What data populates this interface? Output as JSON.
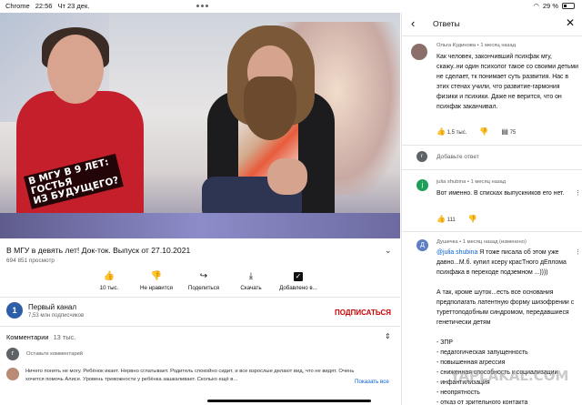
{
  "status_bar": {
    "browser": "Chrome",
    "time": "22:56",
    "date": "Чт 23 дек.",
    "battery": "29 %"
  },
  "video": {
    "overlay_caption": [
      "В МГУ В 9 ЛЕТ:",
      "ГОСТЬЯ",
      "ИЗ БУДУЩЕГО?"
    ],
    "title": "В МГУ в девять лет! Док-ток. Выпуск от 27.10.2021",
    "views": "694 851 просмотр"
  },
  "actions": [
    {
      "icon": "like-icon",
      "glyph": "👍",
      "label": "10 тыс."
    },
    {
      "icon": "dislike-icon",
      "glyph": "👎",
      "label": "Не нравится"
    },
    {
      "icon": "share-icon",
      "glyph": "↪",
      "label": "Поделиться"
    },
    {
      "icon": "download-icon",
      "glyph": "⤓",
      "label": "Скачать"
    },
    {
      "icon": "save-icon",
      "glyph": "✓",
      "label": "Добавлено в..."
    }
  ],
  "channel": {
    "logo": "1",
    "name": "Первый канал",
    "subscribers": "7,53 млн подписчиков",
    "subscribe_label": "ПОДПИСАТЬСЯ"
  },
  "comments": {
    "header": "Комментарии",
    "count": "13 тыс.",
    "add_placeholder": "Оставьте комментарий",
    "top_comment": "Ничего понять не могу. Ребёнок икает. Нервно сглатывает. Родитель спокойно сидит, и все взрослые делают вид, что не видят. Очень хочется помочь Алисе. Уровень тревожности у ребёнка зашкаливает. Сколько ещё в...",
    "show_all": "Показать все"
  },
  "panel": {
    "title": "Ответы",
    "main_comment": {
      "author": "Ольга Кудинова",
      "time": "1 месяц назад",
      "text": "Как человек, закончивший психфак мгу, скажу..ни один психолог такое со своими детьми не сделает, тк понимает суть развития. Нас в этих стенах учили, что развитие-гармония физики и психики. Даже не верится, что он психфак заканчивал.",
      "likes": "1,5 тыс.",
      "replies": "75"
    },
    "reply_avatar": "r",
    "add_reply": "Добавьте ответ",
    "replies": [
      {
        "avatar_letter": "j",
        "author": "julia shubina",
        "time": "1 месяц назад",
        "text": "Вот именно. В списках выпускников его нет.",
        "likes": "111"
      },
      {
        "avatar_letter": "Д",
        "author": "Душечка",
        "time": "1 месяц назад (изменено)",
        "mention": "@julia shubina",
        "text": " Я тоже писала об этом уже давно...М.б. купил ксеру красТного дЕплома психфака в переходе подземном ...))))",
        "text2": "А так, кроме шуток...есть все основания предполагать латентную форму шизофрении с туреттоподобным синдромом, передавшиеся генетически детям",
        "list": [
          "- ЗПР",
          "- педагогическая запущенность",
          "- повышенная агрессия",
          "- сниженная способность к социализации",
          "- инфантилизация",
          "- неопрятность",
          "- отказ от зрительного контакта"
        ]
      }
    ]
  },
  "watermark": "YAPLAKAL.COM",
  "colors": {
    "accent": "#065fd4",
    "subscribe": "#cc0000",
    "tshirt": "#c41f2b"
  }
}
